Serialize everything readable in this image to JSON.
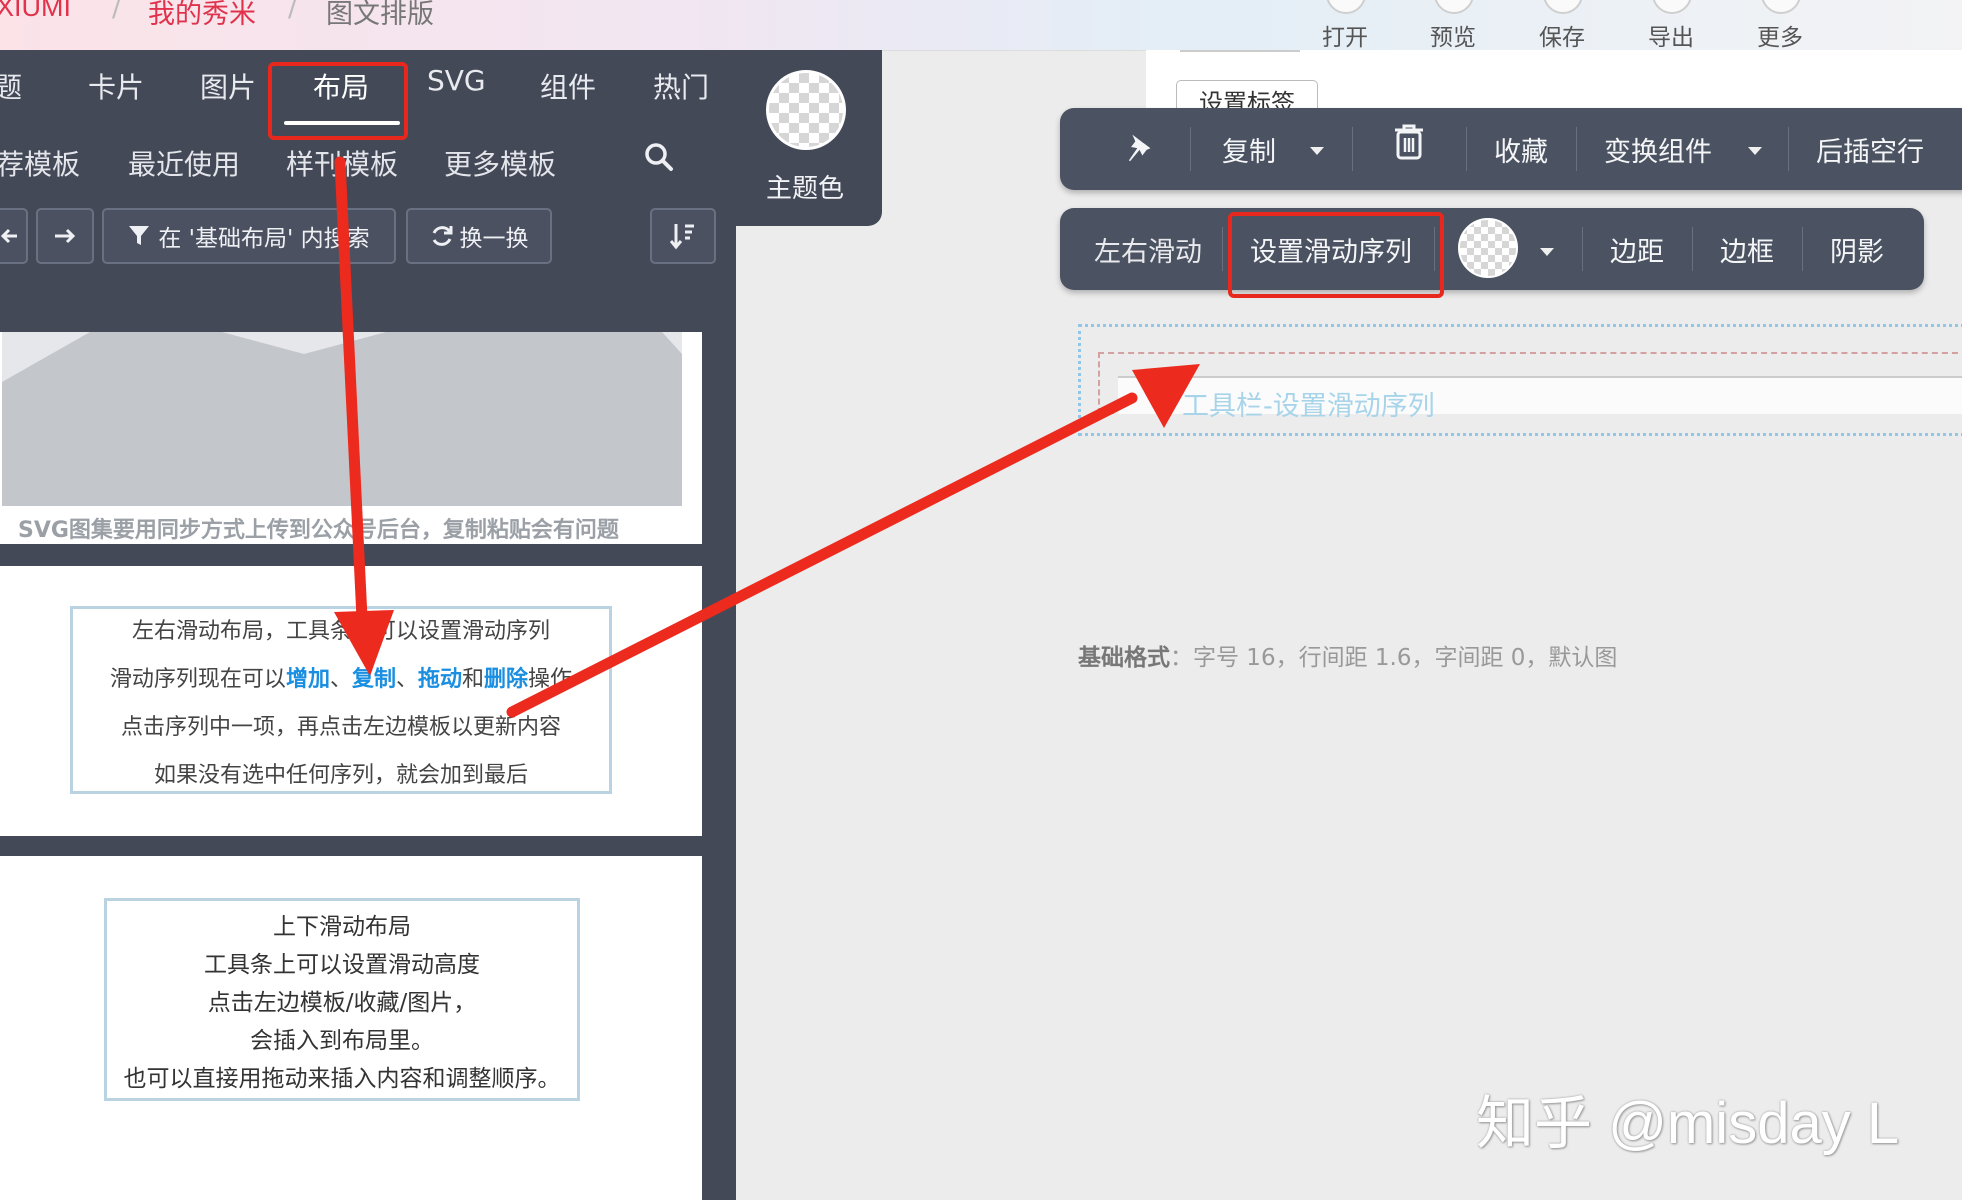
{
  "header": {
    "brand": "XIUMI",
    "crumb_my_show": "我的秀米",
    "crumb_current": "图文排版",
    "tools": [
      "打开",
      "预览",
      "保存",
      "导出",
      "更多"
    ]
  },
  "left_panel": {
    "main_tabs": [
      "题",
      "卡片",
      "图片",
      "布局",
      "SVG",
      "组件",
      "热门"
    ],
    "active_tab": "布局",
    "sub_tabs": [
      "荐模板",
      "最近使用",
      "样刊模板",
      "更多模板"
    ],
    "filter_button": "在 '基础布局' 内搜索",
    "shuffle_button": "换一换",
    "theme_color_label": "主题色",
    "svg_caption": "SVG图集要用同步方式上传到公众号后台，复制粘贴会有问题",
    "horizontal_card": {
      "line1": "左右滑动布局，工具条上可以设置滑动序列",
      "line2_prefix": "滑动序列现在可以",
      "op_add": "增加",
      "sep1": "、",
      "op_copy": "复制",
      "sep2": "、",
      "op_drag": "拖动",
      "and": "和",
      "op_delete": "删除",
      "line2_suffix": "操作",
      "line3": "点击序列中一项，再点击左边模板以更新内容",
      "line4": "如果没有选中任何序列，就会加到最后"
    },
    "vertical_card": {
      "line1": "上下滑动布局",
      "line2": "工具条上可以设置滑动高度",
      "line3": "点击左边模板/收藏/图片，",
      "line4": "会插入到布局里。",
      "line5": "也可以直接用拖动来插入内容和调整顺序。"
    }
  },
  "editor": {
    "tag_button": "设置标签",
    "toolbar1": {
      "copy": "复制",
      "favorite": "收藏",
      "transform": "变换组件",
      "insert_after": "后插空行"
    },
    "toolbar2": {
      "horizontal_slide": "左右滑动",
      "set_sequence": "设置滑动序列",
      "margin": "边距",
      "border": "边框",
      "shadow": "阴影"
    },
    "slide_placeholder": "工具栏-设置滑动序列",
    "basic_format_label": "基础格式",
    "basic_format_value": "：字号 16，行间距 1.6，字间距 0，默认图"
  },
  "watermark": "知乎 @misday L",
  "colors": {
    "panel": "#434957",
    "accent_red": "#e8271d",
    "link_blue": "#1a8ee0"
  }
}
